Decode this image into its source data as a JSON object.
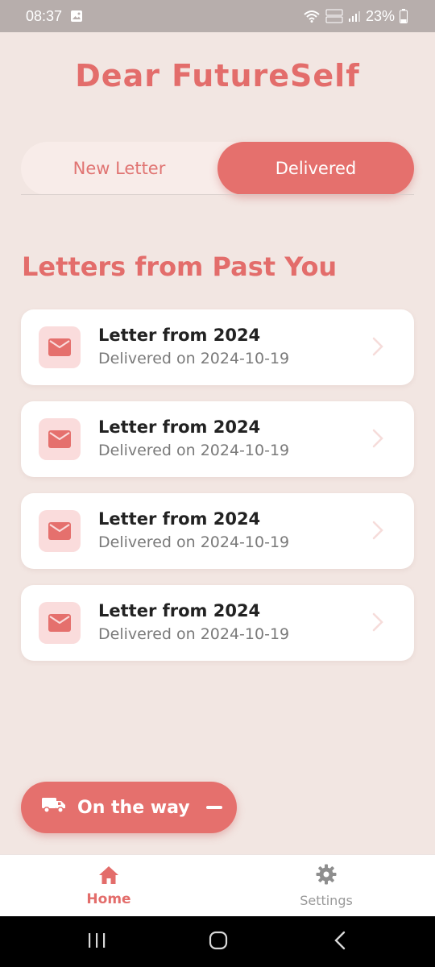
{
  "status_bar": {
    "time": "08:37",
    "battery": "23%",
    "icons": [
      "image-icon",
      "wifi-icon",
      "volte-icon",
      "signal-icon",
      "battery-icon"
    ]
  },
  "app": {
    "title": "Dear FutureSelf",
    "accent_color": "#e5706d"
  },
  "tabs": {
    "new_letter": "New Letter",
    "delivered": "Delivered",
    "active": "Delivered"
  },
  "section_title": "Letters from Past You",
  "letters": [
    {
      "title": "Letter from 2024",
      "subtitle": "Delivered on 2024-10-19"
    },
    {
      "title": "Letter from 2024",
      "subtitle": "Delivered on 2024-10-19"
    },
    {
      "title": "Letter from 2024",
      "subtitle": "Delivered on 2024-10-19"
    },
    {
      "title": "Letter from 2024",
      "subtitle": "Delivered on 2024-10-19"
    }
  ],
  "fab": {
    "label": "On the way",
    "icon": "truck-icon"
  },
  "bottom_nav": {
    "home": "Home",
    "settings": "Settings",
    "active": "Home"
  }
}
